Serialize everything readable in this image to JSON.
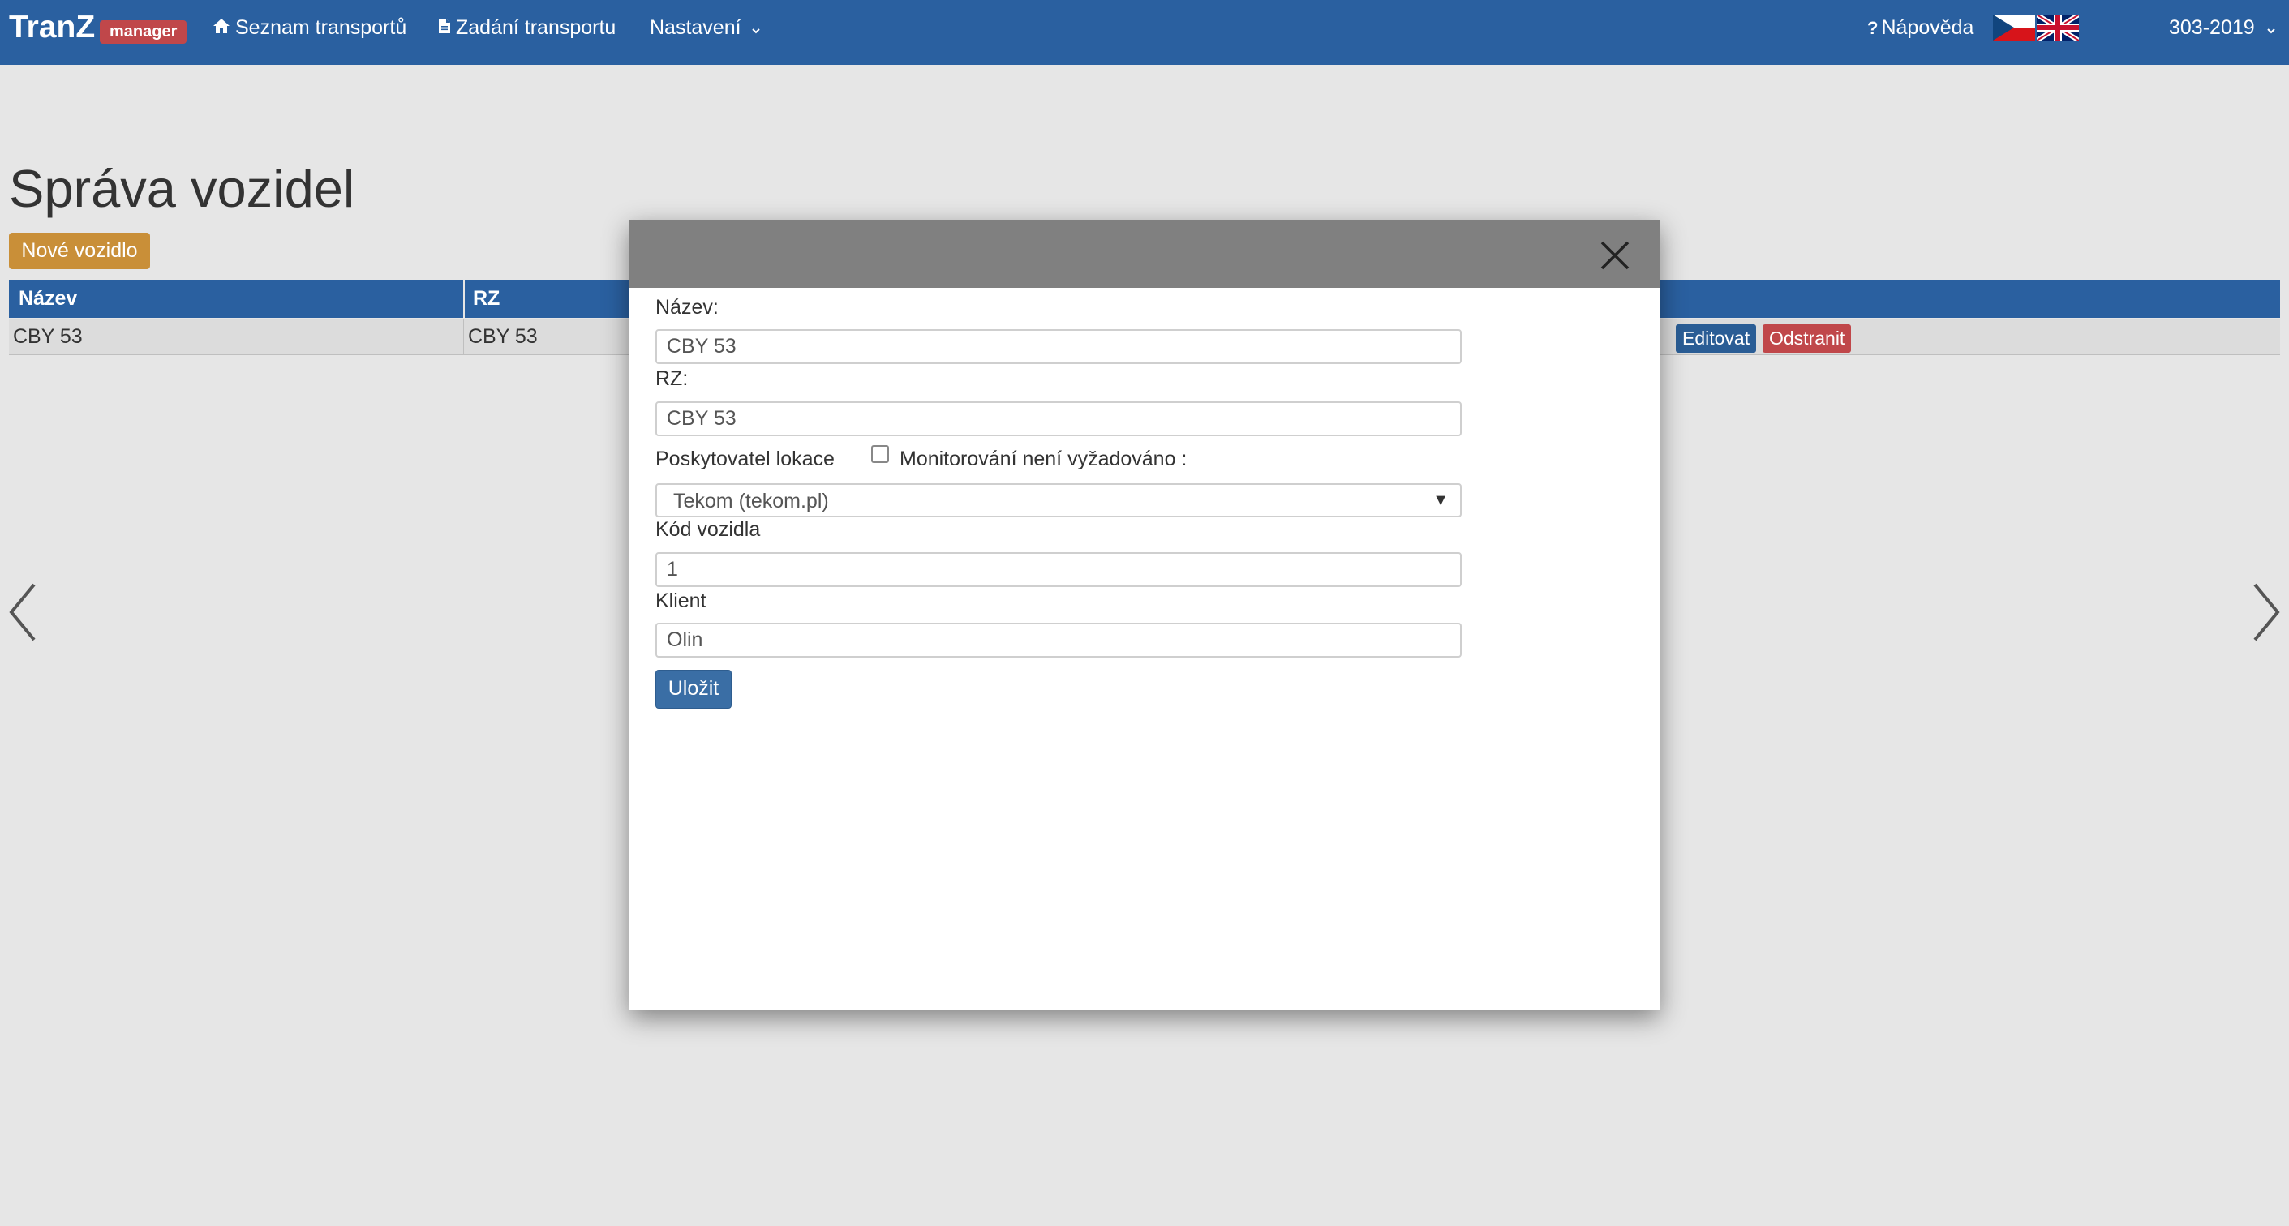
{
  "navbar": {
    "brand": "TranZ",
    "badge": "manager",
    "items": [
      {
        "label": "Seznam transportů",
        "icon": "home-icon"
      },
      {
        "label": "Zadání transportu",
        "icon": "document-icon"
      },
      {
        "label": "Nastavení",
        "icon": "chevron-down-icon"
      }
    ],
    "help_label": "Nápověda",
    "user_label": "303-2019"
  },
  "page": {
    "title": "Správa vozidel",
    "new_button": "Nové vozidlo"
  },
  "table": {
    "columns": [
      "Název",
      "RZ"
    ],
    "rows": [
      {
        "name": "CBY 53",
        "rz": "CBY 53",
        "edit": "Editovat",
        "delete": "Odstranit"
      }
    ]
  },
  "modal": {
    "fields": {
      "name_label": "Název:",
      "name_value": "CBY 53",
      "rz_label": "RZ:",
      "rz_value": "CBY 53",
      "provider_label": "Poskytovatel lokace",
      "monitoring_label": "Monitorování není vyžadováno :",
      "provider_value": "Tekom (tekom.pl)",
      "code_label": "Kód vozidla",
      "code_value": "1",
      "client_label": "Klient",
      "client_value": "Olin"
    },
    "save_label": "Uložit"
  },
  "colors": {
    "navbar": "#2a60a0",
    "badge": "#c0474a",
    "new_button": "#c98f38",
    "edit_button": "#2a5d95",
    "delete_button": "#c0474a",
    "modal_header": "#808080",
    "save_button": "#3a6ea5"
  }
}
